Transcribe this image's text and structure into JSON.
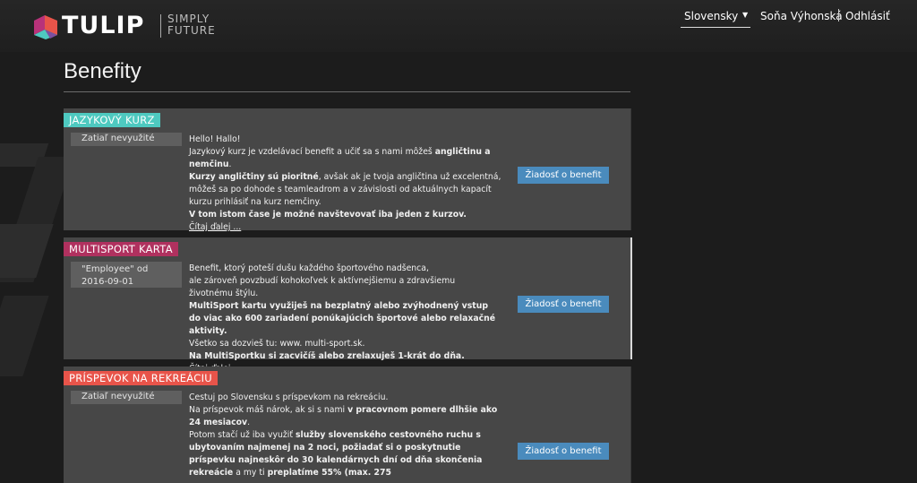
{
  "header": {
    "brand": "TULIP",
    "tagline_1": "SIMPLY",
    "tagline_2": "FUTURE",
    "language": "Slovensky",
    "user": "Soňa Výhonská",
    "logout": "Odhlásiť"
  },
  "page": {
    "title": "Benefity"
  },
  "colors": {
    "tag_language": "#4ec9c0",
    "tag_multisport": "#b0315f",
    "tag_recreation": "#e8544a",
    "button": "#4a8bbd"
  },
  "benefits": [
    {
      "tag": "JAZYKOVÝ KURZ",
      "status": "Zatiaľ nevyužité",
      "lines": [
        "Hello! Hallo!",
        "Jazykový kurz je vzdelávací benefit a učiť sa s nami môžeš ",
        "angličtinu a nemčinu",
        ".",
        "Kurzy angličtiny sú pioritné",
        ", avšak ak je tvoja angličtina už excelentná, môžeš sa po dohode s teamleadrom a v závislosti od aktuálnych kapacít kurzu prihlásiť na kurz nemčiny.",
        "V tom istom čase je možné navštevovať iba jeden z kurzov."
      ],
      "more": "Čítaj ďalej ...",
      "button": "Žiadosť o benefit"
    },
    {
      "tag": "MULTISPORT KARTA",
      "status": "\"Employee\" od 2016-09-01",
      "lines": [
        "Benefit, ktorý poteší dušu každého športového nadšenca,",
        "ale zároveň povzbudí kohokoľvek k aktívnejšiemu a zdravšiemu životnému štýlu.",
        "MultiSport kartu využiješ na bezplatný alebo zvýhodnený vstup do viac ako 600 zariadení ponúkajúcich športové alebo relaxačné aktivity.",
        "Všetko sa dozvieš tu: www. multi-sport.sk.",
        "Na MultiSportku si zacvičíš alebo zrelaxuješ 1-krát do dňa."
      ],
      "more": "Čítaj ďalej ...",
      "button": "Žiadosť o benefit"
    },
    {
      "tag": "PRÍSPEVOK NA REKREÁCIU",
      "status": "Zatiaľ nevyužité",
      "lines": [
        "Cestuj po Slovensku s príspevkom na rekreáciu.",
        "Na príspevok máš nárok, ak si s nami ",
        "v pracovnom pomere dlhšie ako 24 mesiacov",
        ".",
        "Potom stačí už iba využiť ",
        "služby slovenského cestovného ruchu s ubytovaním najmenej na 2 noci, požiadať si o poskytnutie príspevku najneskôr do 30 kalendárnych dní od dňa skončenia rekreácie",
        " a my ti ",
        "preplatíme 55% (max. 275"
      ],
      "button": "Žiadosť o benefit"
    }
  ]
}
